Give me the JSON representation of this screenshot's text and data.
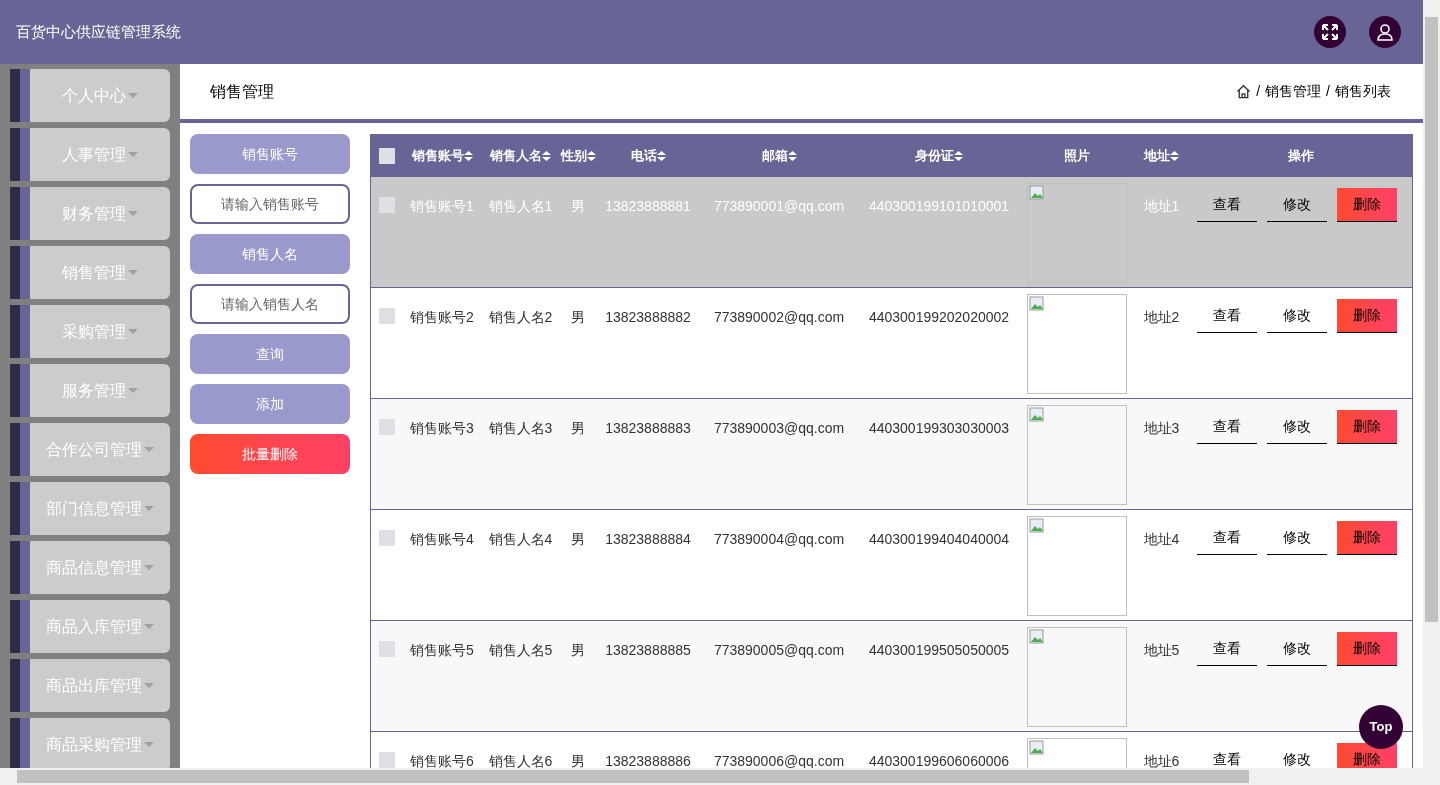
{
  "header": {
    "title": "百货中心供应链管理系统"
  },
  "sidebar": {
    "items": [
      {
        "label": "个人中心"
      },
      {
        "label": "人事管理"
      },
      {
        "label": "财务管理"
      },
      {
        "label": "销售管理"
      },
      {
        "label": "采购管理"
      },
      {
        "label": "服务管理"
      },
      {
        "label": "合作公司管理"
      },
      {
        "label": "部门信息管理"
      },
      {
        "label": "商品信息管理"
      },
      {
        "label": "商品入库管理"
      },
      {
        "label": "商品出库管理"
      },
      {
        "label": "商品采购管理"
      }
    ]
  },
  "page": {
    "title": "销售管理",
    "breadcrumb_separator": "/",
    "breadcrumb": [
      "销售管理",
      "销售列表"
    ]
  },
  "search": {
    "fields": [
      {
        "label": "销售账号",
        "placeholder": "请输入销售账号"
      },
      {
        "label": "销售人名",
        "placeholder": "请输入销售人名"
      }
    ],
    "buttons": [
      {
        "label": "查询",
        "kind": "primary"
      },
      {
        "label": "添加",
        "kind": "primary"
      },
      {
        "label": "批量删除",
        "kind": "danger"
      }
    ]
  },
  "table": {
    "select_all_checked": false,
    "columns": [
      {
        "label": "销售账号",
        "sortable": true
      },
      {
        "label": "销售人名",
        "sortable": true
      },
      {
        "label": "性别",
        "sortable": true
      },
      {
        "label": "电话",
        "sortable": true
      },
      {
        "label": "邮箱",
        "sortable": true
      },
      {
        "label": "身份证",
        "sortable": true
      },
      {
        "label": "照片",
        "sortable": false
      },
      {
        "label": "地址",
        "sortable": true
      },
      {
        "label": "操作",
        "sortable": false
      }
    ],
    "rows": [
      {
        "checked": false,
        "highlighted": true,
        "cells": [
          "销售账号1",
          "销售人名1",
          "男",
          "13823888881",
          "773890001@qq.com",
          "440300199101010001",
          {
            "kind": "picture"
          },
          "地址1"
        ],
        "actions": [
          {
            "label": "查看",
            "kind": "link"
          },
          {
            "label": "修改",
            "kind": "link"
          },
          {
            "label": "删除",
            "kind": "danger"
          }
        ]
      },
      {
        "checked": false,
        "highlighted": false,
        "cells": [
          "销售账号2",
          "销售人名2",
          "男",
          "13823888882",
          "773890002@qq.com",
          "440300199202020002",
          {
            "kind": "picture"
          },
          "地址2"
        ],
        "actions": [
          {
            "label": "查看",
            "kind": "link"
          },
          {
            "label": "修改",
            "kind": "link"
          },
          {
            "label": "删除",
            "kind": "danger"
          }
        ]
      },
      {
        "checked": false,
        "highlighted": false,
        "cells": [
          "销售账号3",
          "销售人名3",
          "男",
          "13823888883",
          "773890003@qq.com",
          "440300199303030003",
          {
            "kind": "picture"
          },
          "地址3"
        ],
        "actions": [
          {
            "label": "查看",
            "kind": "link"
          },
          {
            "label": "修改",
            "kind": "link"
          },
          {
            "label": "删除",
            "kind": "danger"
          }
        ]
      },
      {
        "checked": false,
        "highlighted": false,
        "cells": [
          "销售账号4",
          "销售人名4",
          "男",
          "13823888884",
          "773890004@qq.com",
          "440300199404040004",
          {
            "kind": "picture"
          },
          "地址4"
        ],
        "actions": [
          {
            "label": "查看",
            "kind": "link"
          },
          {
            "label": "修改",
            "kind": "link"
          },
          {
            "label": "删除",
            "kind": "danger"
          }
        ]
      },
      {
        "checked": false,
        "highlighted": false,
        "cells": [
          "销售账号5",
          "销售人名5",
          "男",
          "13823888885",
          "773890005@qq.com",
          "440300199505050005",
          {
            "kind": "picture"
          },
          "地址5"
        ],
        "actions": [
          {
            "label": "查看",
            "kind": "link"
          },
          {
            "label": "修改",
            "kind": "link"
          },
          {
            "label": "删除",
            "kind": "danger"
          }
        ]
      },
      {
        "checked": false,
        "highlighted": false,
        "cells": [
          "销售账号6",
          "销售人名6",
          "男",
          "13823888886",
          "773890006@qq.com",
          "440300199606060006",
          {
            "kind": "picture"
          },
          "地址6"
        ],
        "actions": [
          {
            "label": "查看",
            "kind": "link"
          },
          {
            "label": "修改",
            "kind": "link"
          },
          {
            "label": "删除",
            "kind": "danger"
          }
        ]
      }
    ]
  },
  "back_to_top": "Top"
}
